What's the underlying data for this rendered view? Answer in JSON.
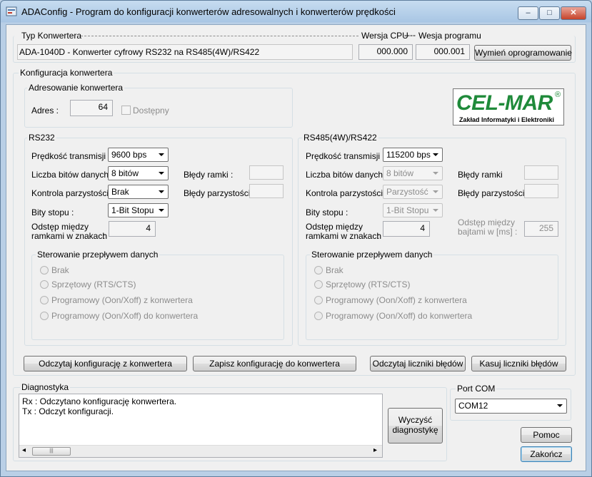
{
  "window": {
    "title": "ADAConfig - Program do konfiguracji konwerterów adresowalnych i konwerterów prędkości",
    "min": "–",
    "max": "□",
    "close": "✕"
  },
  "top": {
    "typ_label": "Typ Konwertera",
    "typ_value": "ADA-1040D - Konwerter cyfrowy RS232 na RS485(4W)/RS422",
    "cpu_label": "Wersja CPU",
    "sep": "----",
    "prog_label": "Wesja programu",
    "cpu_value": "000.000",
    "prog_value": "000.001",
    "update_btn": "Wymień oprogramowanie"
  },
  "config": {
    "title": "Konfiguracja konwertera"
  },
  "addr": {
    "title": "Adresowanie konwertera",
    "adres_label": "Adres :",
    "adres_value": "64",
    "dostepny_label": "Dostępny"
  },
  "logo": {
    "brand": "CEL-MAR",
    "reg": "®",
    "sub": "Zakład Informatyki i Elektroniki"
  },
  "rs232": {
    "title": "RS232",
    "speed_label": "Prędkość transmisji :",
    "speed_value": "9600 bps",
    "bits_label": "Liczba bitów danych :",
    "bits_value": "8 bitów",
    "parity_label": "Kontrola parzystości :",
    "parity_value": "Brak",
    "stop_label": "Bity stopu :",
    "stop_value": "1-Bit Stopu",
    "gap_label1": "Odstęp między",
    "gap_label2": "ramkami w znakach",
    "gap_colon": ":",
    "gap_value": "4",
    "frame_err_label": "Błędy ramki :",
    "parity_err_label": "Błędy parzystości :",
    "flow_title": "Sterowanie przepływem danych",
    "flow_opts": [
      "Brak",
      "Sprzętowy (RTS/CTS)",
      "Programowy (Oon/Xoff) z konwertera",
      "Programowy (Oon/Xoff) do konwertera"
    ]
  },
  "rs485": {
    "title": "RS485(4W)/RS422",
    "speed_label": "Prędkość transmisji :",
    "speed_value": "115200 bps",
    "bits_label": "Liczba bitów danych :",
    "bits_value": "8 bitów",
    "parity_label": "Kontrola parzystości :",
    "parity_value": "Parzystość",
    "stop_label": "Bity stopu :",
    "stop_value": "1-Bit Stopu",
    "gap_label1": "Odstęp między",
    "gap_label2": "ramkami w znakach",
    "gap_colon": ":",
    "gap_value": "4",
    "frame_err_label": "Błędy ramki",
    "parity_err_label": "Błędy parzystości",
    "byte_gap_label1": "Odstęp między",
    "byte_gap_label2": "bajtami w [ms] :",
    "byte_gap_value": "255",
    "flow_title": "Sterowanie przepływem danych",
    "flow_opts": [
      "Brak",
      "Sprzętowy (RTS/CTS)",
      "Programowy (Oon/Xoff) z konwertera",
      "Programowy (Oon/Xoff) do konwertera"
    ]
  },
  "actions": {
    "read_cfg": "Odczytaj konfigurację z konwertera",
    "write_cfg": "Zapisz konfigurację do konwertera",
    "read_err": "Odczytaj liczniki błędów",
    "clear_err": "Kasuj liczniki błędów"
  },
  "diag": {
    "title": "Diagnostyka",
    "lines": [
      "Rx : Odczytano konfigurację konwertera.",
      "Tx : Odczyt konfiguracji."
    ],
    "clear_btn1": "Wyczyść",
    "clear_btn2": "diagnostykę",
    "scroll_left": "◂",
    "scroll_thumb": "|||",
    "scroll_right": "▸"
  },
  "port": {
    "title": "Port COM",
    "value": "COM12"
  },
  "help_btn": "Pomoc",
  "close_btn": "Zakończ"
}
